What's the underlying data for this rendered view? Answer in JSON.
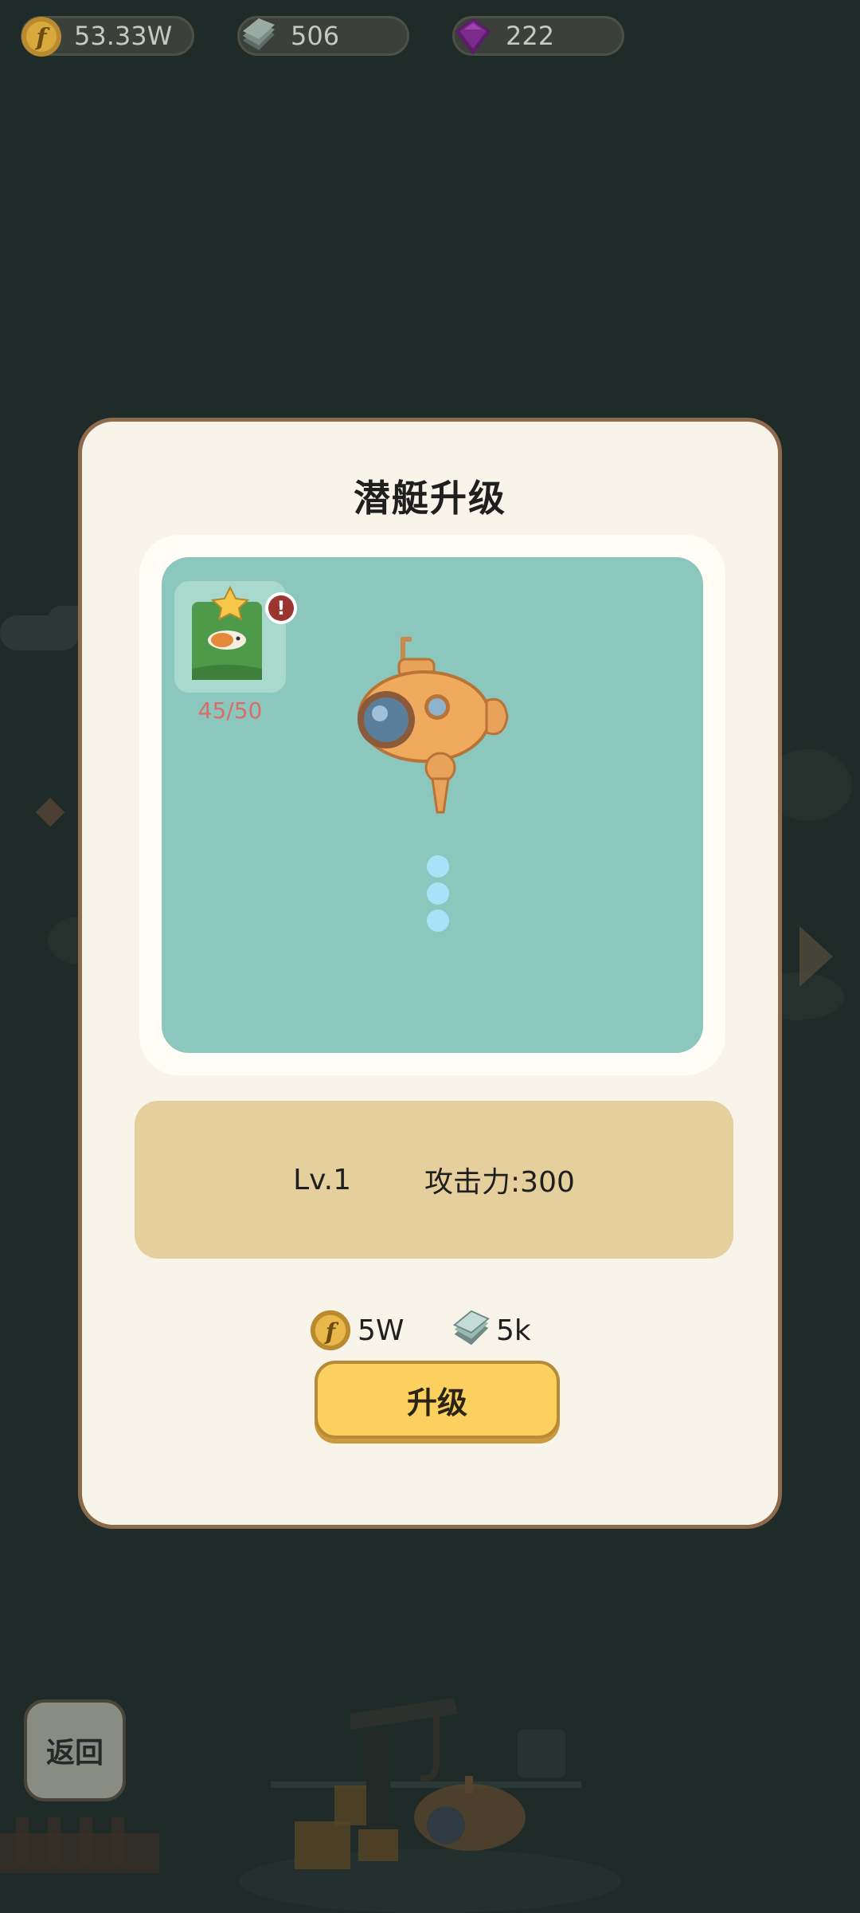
{
  "resources": {
    "gold": {
      "icon": "gold-coin-icon",
      "value": "53.33W"
    },
    "material": {
      "icon": "steel-plate-icon",
      "value": "506"
    },
    "gem": {
      "icon": "purple-gem-icon",
      "value": "222"
    }
  },
  "modal": {
    "title": "潜艇升级",
    "card": {
      "icon": "fish-blueprint-icon",
      "progress": "45/50",
      "badge": "!"
    },
    "submarine_icon": "submarine-icon",
    "stats": {
      "level": "Lv.1",
      "attack": "攻击力:300"
    },
    "cost": {
      "gold": {
        "icon": "gold-coin-icon",
        "amount": "5W"
      },
      "material": {
        "icon": "steel-plate-icon",
        "amount": "5k"
      }
    },
    "upgrade_label": "升级"
  },
  "back_label": "返回",
  "colors": {
    "background": "#243430",
    "modal_bg": "#f9f4ea",
    "modal_border": "#8e6a4c",
    "preview_water": "#8cc7bd",
    "stats_panel": "#e5cf9d",
    "button": "#fcd05e",
    "progress_text": "#d76e6a"
  }
}
